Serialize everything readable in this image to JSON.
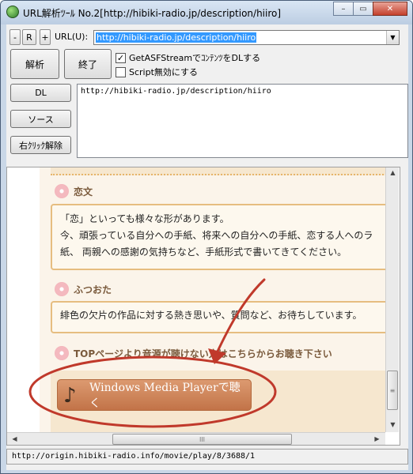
{
  "window": {
    "title": "URL解析ﾂｰﾙ No.2[http://hibiki-radio.jp/description/hiiro]",
    "minimize_label": "–",
    "maximize_label": "▭",
    "close_label": "✕"
  },
  "toolbar": {
    "minus_label": "-",
    "r_label": "R",
    "plus_label": "+",
    "url_label": "URL(U):",
    "url_value": "http://hibiki-radio.jp/description/hiiro",
    "dropdown_arrow": "▼"
  },
  "actions": {
    "parse_label": "解析",
    "exit_label": "終了",
    "dl_label": "DL",
    "source_label": "ソース",
    "rightclick_label": "右ｸﾘｯｸ解除"
  },
  "options": {
    "asf_label": "GetASFStreamでｺﾝﾃﾝﾂをDLする",
    "asf_checked": true,
    "script_label": "Script無効にする",
    "script_checked": false,
    "checkmark": "✓"
  },
  "output_text": "http://hibiki-radio.jp/description/hiiro",
  "page": {
    "sections": [
      {
        "title": "恋文",
        "lines": [
          "「恋」といっても様々な形があります。",
          "今、頑張っている自分への手紙、将来への自分への手紙、恋する人へのラ",
          "紙、 両親への感謝の気持ちなど、手紙形式で書いてきてください。"
        ]
      },
      {
        "title": "ふつおた",
        "lines": [
          "緋色の欠片の作品に対する熱き思いや、質問など、お待ちしています。"
        ]
      },
      {
        "title": "TOPページより音源が聴けない方はこちらからお聴き下さい"
      }
    ],
    "player_button_label": "Windows Media Playerで聴く",
    "note_glyph": "♪"
  },
  "scrollbar": {
    "up": "▲",
    "down": "▼",
    "left": "◀",
    "right": "▶",
    "grip": "≡",
    "hgrip": "III"
  },
  "status_text": "http://origin.hibiki-radio.info/movie/play/8/3688/1",
  "colors": {
    "annotation_red": "#c0392b",
    "selection_blue": "#3399ff",
    "card_border": "#e6bd80",
    "button_orange": "#c27348"
  }
}
